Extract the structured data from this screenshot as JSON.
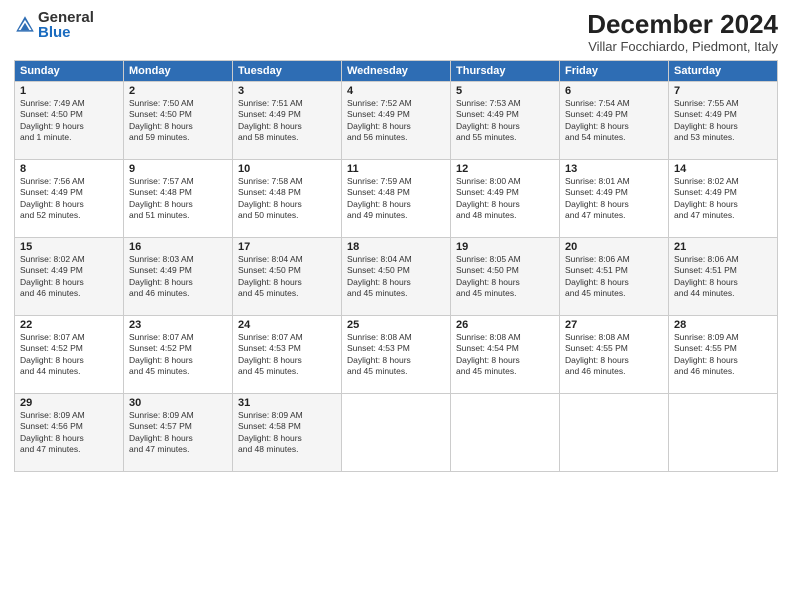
{
  "header": {
    "logo_general": "General",
    "logo_blue": "Blue",
    "title": "December 2024",
    "location": "Villar Focchiardo, Piedmont, Italy"
  },
  "columns": [
    "Sunday",
    "Monday",
    "Tuesday",
    "Wednesday",
    "Thursday",
    "Friday",
    "Saturday"
  ],
  "weeks": [
    [
      {
        "day": "1",
        "info": "Sunrise: 7:49 AM\nSunset: 4:50 PM\nDaylight: 9 hours\nand 1 minute."
      },
      {
        "day": "2",
        "info": "Sunrise: 7:50 AM\nSunset: 4:50 PM\nDaylight: 8 hours\nand 59 minutes."
      },
      {
        "day": "3",
        "info": "Sunrise: 7:51 AM\nSunset: 4:49 PM\nDaylight: 8 hours\nand 58 minutes."
      },
      {
        "day": "4",
        "info": "Sunrise: 7:52 AM\nSunset: 4:49 PM\nDaylight: 8 hours\nand 56 minutes."
      },
      {
        "day": "5",
        "info": "Sunrise: 7:53 AM\nSunset: 4:49 PM\nDaylight: 8 hours\nand 55 minutes."
      },
      {
        "day": "6",
        "info": "Sunrise: 7:54 AM\nSunset: 4:49 PM\nDaylight: 8 hours\nand 54 minutes."
      },
      {
        "day": "7",
        "info": "Sunrise: 7:55 AM\nSunset: 4:49 PM\nDaylight: 8 hours\nand 53 minutes."
      }
    ],
    [
      {
        "day": "8",
        "info": "Sunrise: 7:56 AM\nSunset: 4:49 PM\nDaylight: 8 hours\nand 52 minutes."
      },
      {
        "day": "9",
        "info": "Sunrise: 7:57 AM\nSunset: 4:48 PM\nDaylight: 8 hours\nand 51 minutes."
      },
      {
        "day": "10",
        "info": "Sunrise: 7:58 AM\nSunset: 4:48 PM\nDaylight: 8 hours\nand 50 minutes."
      },
      {
        "day": "11",
        "info": "Sunrise: 7:59 AM\nSunset: 4:48 PM\nDaylight: 8 hours\nand 49 minutes."
      },
      {
        "day": "12",
        "info": "Sunrise: 8:00 AM\nSunset: 4:49 PM\nDaylight: 8 hours\nand 48 minutes."
      },
      {
        "day": "13",
        "info": "Sunrise: 8:01 AM\nSunset: 4:49 PM\nDaylight: 8 hours\nand 47 minutes."
      },
      {
        "day": "14",
        "info": "Sunrise: 8:02 AM\nSunset: 4:49 PM\nDaylight: 8 hours\nand 47 minutes."
      }
    ],
    [
      {
        "day": "15",
        "info": "Sunrise: 8:02 AM\nSunset: 4:49 PM\nDaylight: 8 hours\nand 46 minutes."
      },
      {
        "day": "16",
        "info": "Sunrise: 8:03 AM\nSunset: 4:49 PM\nDaylight: 8 hours\nand 46 minutes."
      },
      {
        "day": "17",
        "info": "Sunrise: 8:04 AM\nSunset: 4:50 PM\nDaylight: 8 hours\nand 45 minutes."
      },
      {
        "day": "18",
        "info": "Sunrise: 8:04 AM\nSunset: 4:50 PM\nDaylight: 8 hours\nand 45 minutes."
      },
      {
        "day": "19",
        "info": "Sunrise: 8:05 AM\nSunset: 4:50 PM\nDaylight: 8 hours\nand 45 minutes."
      },
      {
        "day": "20",
        "info": "Sunrise: 8:06 AM\nSunset: 4:51 PM\nDaylight: 8 hours\nand 45 minutes."
      },
      {
        "day": "21",
        "info": "Sunrise: 8:06 AM\nSunset: 4:51 PM\nDaylight: 8 hours\nand 44 minutes."
      }
    ],
    [
      {
        "day": "22",
        "info": "Sunrise: 8:07 AM\nSunset: 4:52 PM\nDaylight: 8 hours\nand 44 minutes."
      },
      {
        "day": "23",
        "info": "Sunrise: 8:07 AM\nSunset: 4:52 PM\nDaylight: 8 hours\nand 45 minutes."
      },
      {
        "day": "24",
        "info": "Sunrise: 8:07 AM\nSunset: 4:53 PM\nDaylight: 8 hours\nand 45 minutes."
      },
      {
        "day": "25",
        "info": "Sunrise: 8:08 AM\nSunset: 4:53 PM\nDaylight: 8 hours\nand 45 minutes."
      },
      {
        "day": "26",
        "info": "Sunrise: 8:08 AM\nSunset: 4:54 PM\nDaylight: 8 hours\nand 45 minutes."
      },
      {
        "day": "27",
        "info": "Sunrise: 8:08 AM\nSunset: 4:55 PM\nDaylight: 8 hours\nand 46 minutes."
      },
      {
        "day": "28",
        "info": "Sunrise: 8:09 AM\nSunset: 4:55 PM\nDaylight: 8 hours\nand 46 minutes."
      }
    ],
    [
      {
        "day": "29",
        "info": "Sunrise: 8:09 AM\nSunset: 4:56 PM\nDaylight: 8 hours\nand 47 minutes."
      },
      {
        "day": "30",
        "info": "Sunrise: 8:09 AM\nSunset: 4:57 PM\nDaylight: 8 hours\nand 47 minutes."
      },
      {
        "day": "31",
        "info": "Sunrise: 8:09 AM\nSunset: 4:58 PM\nDaylight: 8 hours\nand 48 minutes."
      },
      null,
      null,
      null,
      null
    ]
  ]
}
